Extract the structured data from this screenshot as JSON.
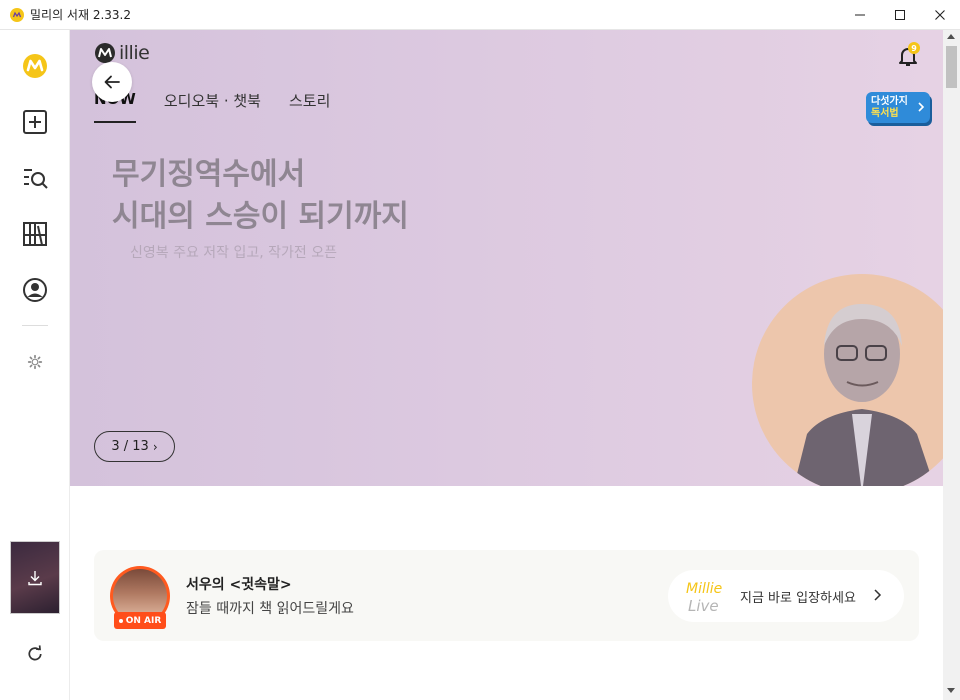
{
  "window": {
    "title": "밀리의 서재 2.33.2",
    "controls": [
      "minimize-icon",
      "maximize-icon",
      "close-icon"
    ]
  },
  "sidebar": {
    "items": [
      {
        "icon": "millie-logo-icon"
      },
      {
        "icon": "add-library-icon"
      },
      {
        "icon": "search-list-icon"
      },
      {
        "icon": "bookshelf-icon"
      },
      {
        "icon": "profile-icon"
      },
      {
        "icon": "gear-icon"
      }
    ],
    "recent_book_icon": "download-icon",
    "refresh_icon": "refresh-icon"
  },
  "header": {
    "logo_text": "illie",
    "bell_badge": "9",
    "tabs": [
      {
        "label": "NOW",
        "active": true
      },
      {
        "label": "오디오북 · 챗북",
        "active": false
      },
      {
        "label": "스토리",
        "active": false
      }
    ],
    "promo": {
      "line1": "다섯가지",
      "line2": "독서법"
    }
  },
  "hero": {
    "headline_1": "무기징역수에서",
    "headline_2": "시대의 스승이 되기까지",
    "subtitle": "신영복 주요 저작 입고, 작가전 오픈",
    "pager": "3 / 13",
    "bg_colors": [
      "#d4c2db",
      "#e6d2e4"
    ],
    "portrait_bg": "#edc6ac"
  },
  "live": {
    "title": "서우의 <귓속말>",
    "subtitle": "잠들 때까지 책 읽어드릴게요",
    "badge": "ON AIR",
    "logo_line1": "Millie",
    "logo_line2": "Live",
    "cta": "지금 바로 입장하세요"
  },
  "colors": {
    "accent_yellow": "#f5c518",
    "onair_red": "#ff4e1a",
    "promo_blue": "#2f8bd9"
  }
}
